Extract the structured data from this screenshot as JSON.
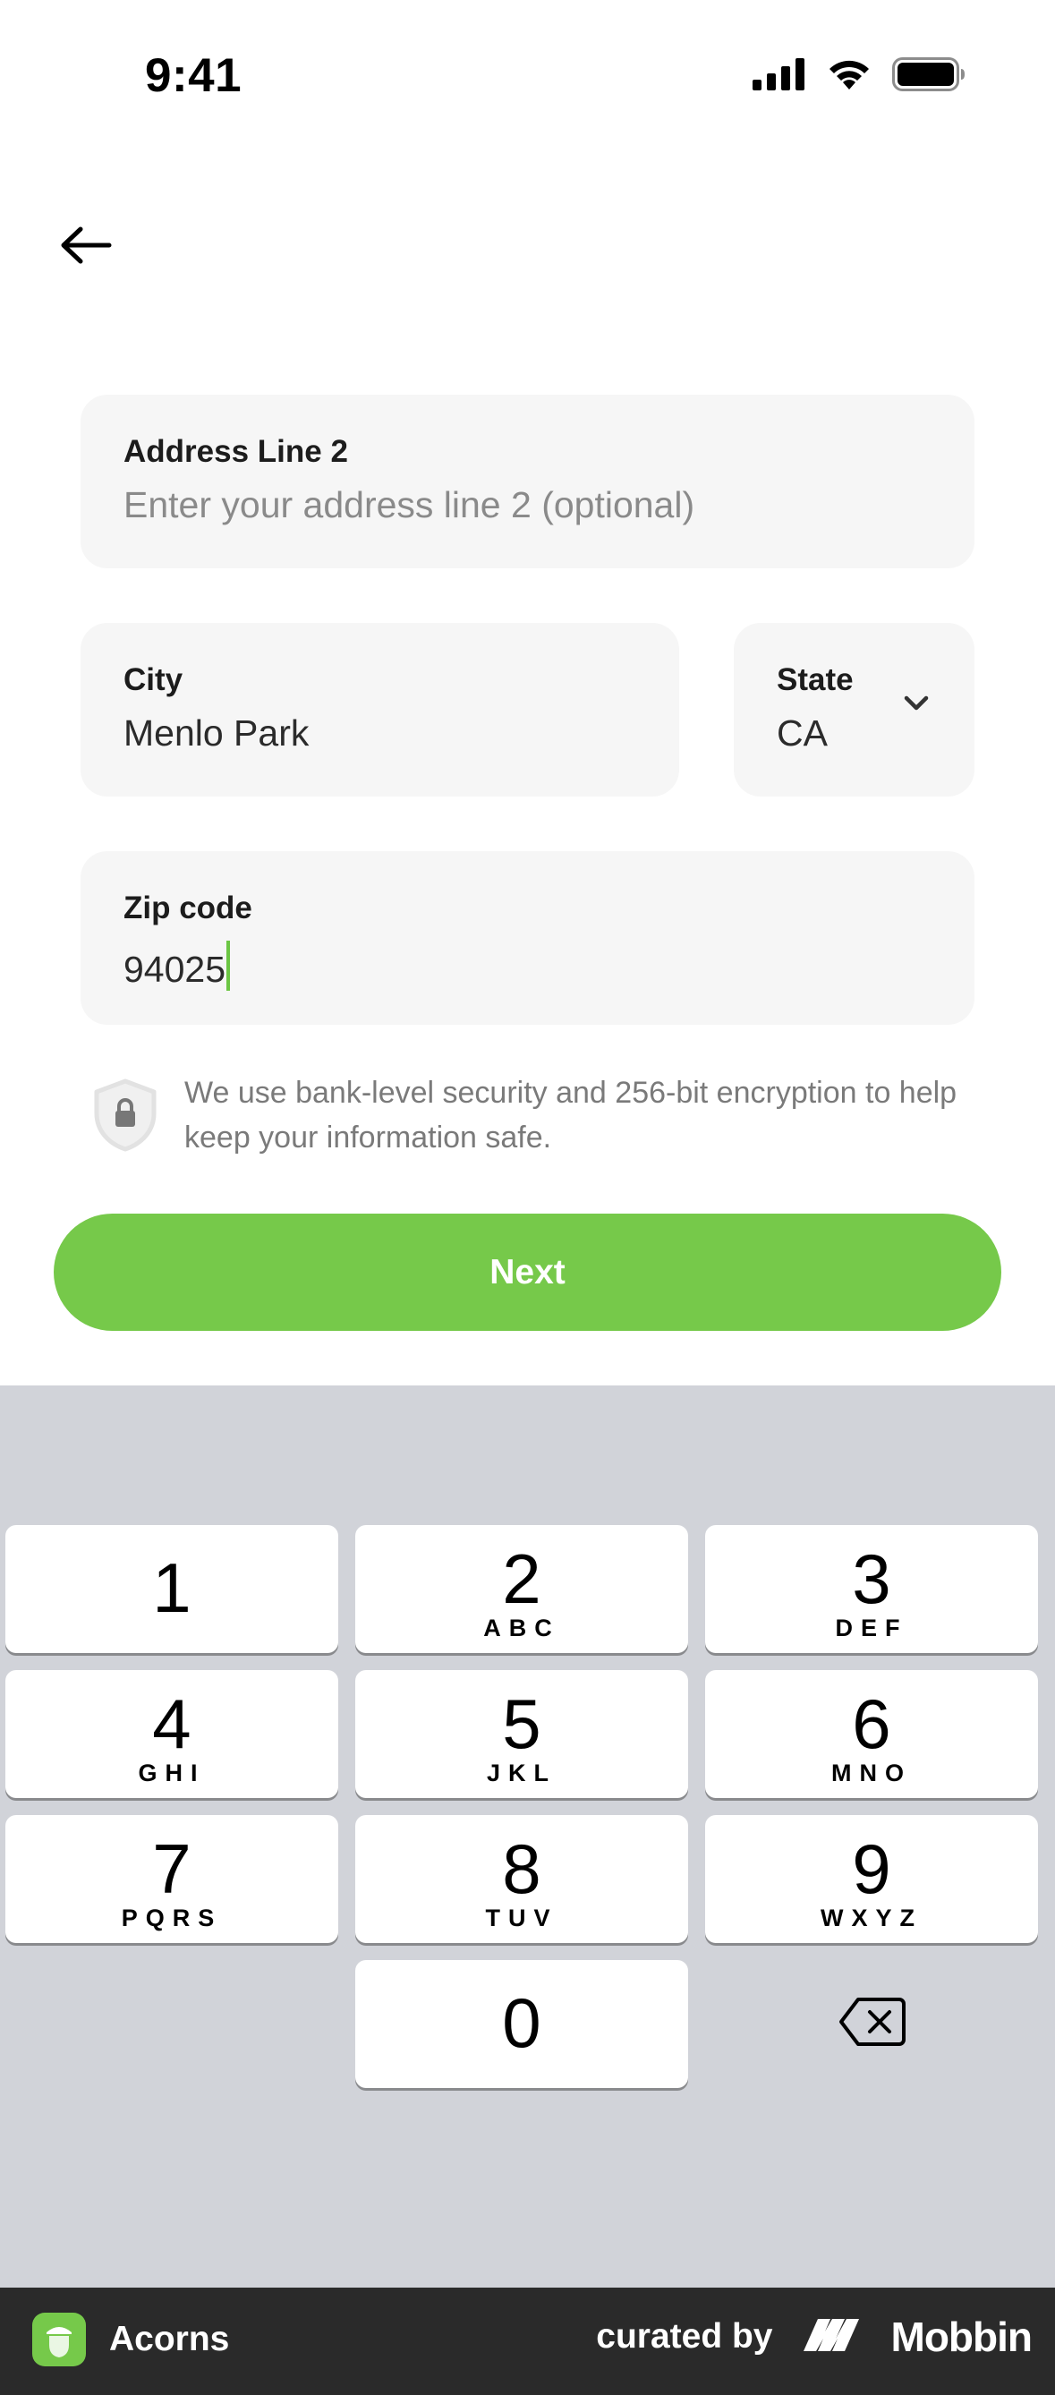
{
  "status_bar": {
    "time": "9:41",
    "icons": [
      "cellular-signal-icon",
      "wifi-icon",
      "battery-icon"
    ]
  },
  "nav": {
    "back_icon": "arrow-left-icon"
  },
  "form": {
    "address_line_2": {
      "label": "Address Line 2",
      "placeholder": "Enter your address line 2 (optional)",
      "value": ""
    },
    "city": {
      "label": "City",
      "value": "Menlo Park"
    },
    "state": {
      "label": "State",
      "value": "CA",
      "icon": "chevron-down-icon"
    },
    "zip": {
      "label": "Zip code",
      "value": "94025"
    }
  },
  "security": {
    "icon": "shield-lock-icon",
    "text": "We use bank-level security and 256-bit encryption to help keep your information safe."
  },
  "next_button": {
    "label": "Next"
  },
  "keypad": {
    "keys": [
      {
        "digit": "1",
        "letters": ""
      },
      {
        "digit": "2",
        "letters": "ABC"
      },
      {
        "digit": "3",
        "letters": "DEF"
      },
      {
        "digit": "4",
        "letters": "GHI"
      },
      {
        "digit": "5",
        "letters": "JKL"
      },
      {
        "digit": "6",
        "letters": "MNO"
      },
      {
        "digit": "7",
        "letters": "PQRS"
      },
      {
        "digit": "8",
        "letters": "TUV"
      },
      {
        "digit": "9",
        "letters": "WXYZ"
      },
      {
        "digit": "0",
        "letters": ""
      }
    ],
    "delete_icon": "backspace-icon"
  },
  "footer": {
    "app_name": "Acorns",
    "curated_by": "curated by",
    "brand": "Mobbin"
  },
  "colors": {
    "accent_green": "#76c94a",
    "field_background": "#f6f6f6",
    "keypad_background": "#d1d3d9",
    "footer_background": "#2a2a2a"
  }
}
